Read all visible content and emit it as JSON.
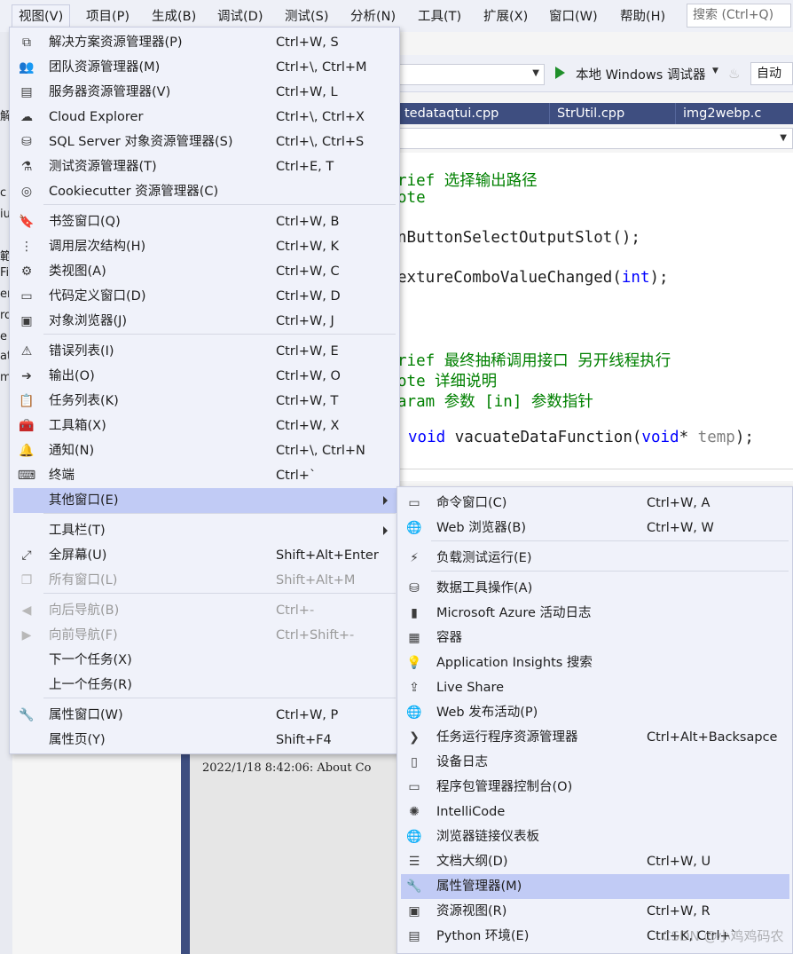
{
  "menubar": {
    "items": [
      "视图(V)",
      "项目(P)",
      "生成(B)",
      "调试(D)",
      "测试(S)",
      "分析(N)",
      "工具(T)",
      "扩展(X)",
      "窗口(W)",
      "帮助(H)"
    ],
    "search_placeholder": "搜索 (Ctrl+Q)"
  },
  "toolbar": {
    "run_label": "本地 Windows 调试器",
    "solution_config": "自动"
  },
  "tabs": [
    "tedataqtui.cpp",
    "StrUtil.cpp",
    "img2webp.c"
  ],
  "code": {
    "line1": {
      "a": "rief ",
      "b": "选择输出路径"
    },
    "line2": "ote",
    "line3": "nButtonSelectOutputSlot();",
    "line4": {
      "a": "extureComboValueChanged(",
      "b": "int",
      "c": ");"
    },
    "line5": {
      "a": "rief ",
      "b": "最终抽稀调用接口 另开线程执行"
    },
    "line6": {
      "a": "ote ",
      "b": "详细说明"
    },
    "line7": {
      "a": "aram ",
      "b": "参数 [in] 参数指针"
    },
    "line8": {
      "a": "void",
      "b": " vacuateDataFunction(",
      "c": "void",
      "d": "* ",
      "e": "temp",
      "f": ");"
    }
  },
  "left_strip": [
    "解",
    "c",
    "iu",
    "範",
    "Fi",
    "er",
    "ro",
    "e",
    "at",
    "mi"
  ],
  "output": {
    "line": "2022/1/18 8:42:06: About Co"
  },
  "view_menu": {
    "items": [
      {
        "icon": "solution-explorer-icon",
        "label": "解决方案资源管理器(P)",
        "shortcut": "Ctrl+W, S"
      },
      {
        "icon": "team-explorer-icon",
        "label": "团队资源管理器(M)",
        "shortcut": "Ctrl+\\, Ctrl+M"
      },
      {
        "icon": "server-explorer-icon",
        "label": "服务器资源管理器(V)",
        "shortcut": "Ctrl+W, L"
      },
      {
        "icon": "cloud-icon",
        "label": "Cloud Explorer",
        "shortcut": "Ctrl+\\, Ctrl+X"
      },
      {
        "icon": "sql-server-icon",
        "label": "SQL Server 对象资源管理器(S)",
        "shortcut": "Ctrl+\\, Ctrl+S"
      },
      {
        "icon": "test-explorer-icon",
        "label": "测试资源管理器(T)",
        "shortcut": "Ctrl+E, T"
      },
      {
        "icon": "cookiecutter-icon",
        "label": "Cookiecutter 资源管理器(C)",
        "shortcut": ""
      },
      {
        "icon": "bookmark-icon",
        "label": "书签窗口(Q)",
        "shortcut": "Ctrl+W, B"
      },
      {
        "icon": "call-hierarchy-icon",
        "label": "调用层次结构(H)",
        "shortcut": "Ctrl+W, K"
      },
      {
        "icon": "class-view-icon",
        "label": "类视图(A)",
        "shortcut": "Ctrl+W, C"
      },
      {
        "icon": "code-definition-icon",
        "label": "代码定义窗口(D)",
        "shortcut": "Ctrl+W, D"
      },
      {
        "icon": "object-browser-icon",
        "label": "对象浏览器(J)",
        "shortcut": "Ctrl+W, J"
      },
      {
        "icon": "error-list-icon",
        "label": "错误列表(I)",
        "shortcut": "Ctrl+W, E"
      },
      {
        "icon": "output-icon",
        "label": "输出(O)",
        "shortcut": "Ctrl+W, O"
      },
      {
        "icon": "task-list-icon",
        "label": "任务列表(K)",
        "shortcut": "Ctrl+W, T"
      },
      {
        "icon": "toolbox-icon",
        "label": "工具箱(X)",
        "shortcut": "Ctrl+W, X"
      },
      {
        "icon": "bell-icon",
        "label": "通知(N)",
        "shortcut": "Ctrl+\\, Ctrl+N"
      },
      {
        "icon": "terminal-icon",
        "label": "终端",
        "shortcut": "Ctrl+`"
      },
      {
        "icon": "",
        "label": "其他窗口(E)",
        "shortcut": ""
      },
      {
        "icon": "",
        "label": "工具栏(T)",
        "shortcut": ""
      },
      {
        "icon": "full-screen-icon",
        "label": "全屏幕(U)",
        "shortcut": "Shift+Alt+Enter"
      },
      {
        "icon": "all-windows-icon",
        "label": "所有窗口(L)",
        "shortcut": "Shift+Alt+M"
      },
      {
        "icon": "navigate-back-icon",
        "label": "向后导航(B)",
        "shortcut": "Ctrl+-"
      },
      {
        "icon": "navigate-forward-icon",
        "label": "向前导航(F)",
        "shortcut": "Ctrl+Shift+-"
      },
      {
        "icon": "",
        "label": "下一个任务(X)",
        "shortcut": ""
      },
      {
        "icon": "",
        "label": "上一个任务(R)",
        "shortcut": ""
      },
      {
        "icon": "wrench-icon",
        "label": "属性窗口(W)",
        "shortcut": "Ctrl+W, P"
      },
      {
        "icon": "",
        "label": "属性页(Y)",
        "shortcut": "Shift+F4"
      }
    ]
  },
  "other_windows_menu": {
    "items": [
      {
        "icon": "command-window-icon",
        "label": "命令窗口(C)",
        "shortcut": "Ctrl+W, A"
      },
      {
        "icon": "web-browser-icon",
        "label": "Web 浏览器(B)",
        "shortcut": "Ctrl+W, W"
      },
      {
        "icon": "load-test-icon",
        "label": "负载测试运行(E)",
        "shortcut": ""
      },
      {
        "icon": "data-tools-icon",
        "label": "数据工具操作(A)",
        "shortcut": ""
      },
      {
        "icon": "azure-log-icon",
        "label": "Microsoft Azure 活动日志",
        "shortcut": ""
      },
      {
        "icon": "container-icon",
        "label": "容器",
        "shortcut": ""
      },
      {
        "icon": "app-insights-icon",
        "label": "Application Insights 搜索",
        "shortcut": ""
      },
      {
        "icon": "live-share-icon",
        "label": "Live Share",
        "shortcut": ""
      },
      {
        "icon": "web-publish-icon",
        "label": "Web 发布活动(P)",
        "shortcut": ""
      },
      {
        "icon": "task-runner-icon",
        "label": "任务运行程序资源管理器",
        "shortcut": "Ctrl+Alt+Backsapce"
      },
      {
        "icon": "device-log-icon",
        "label": "设备日志",
        "shortcut": ""
      },
      {
        "icon": "package-console-icon",
        "label": "程序包管理器控制台(O)",
        "shortcut": ""
      },
      {
        "icon": "intellicode-icon",
        "label": "IntelliCode",
        "shortcut": ""
      },
      {
        "icon": "browser-link-icon",
        "label": "浏览器链接仪表板",
        "shortcut": ""
      },
      {
        "icon": "document-outline-icon",
        "label": "文档大纲(D)",
        "shortcut": "Ctrl+W, U"
      },
      {
        "icon": "property-manager-icon",
        "label": "属性管理器(M)",
        "shortcut": ""
      },
      {
        "icon": "resource-view-icon",
        "label": "资源视图(R)",
        "shortcut": "Ctrl+W, R"
      },
      {
        "icon": "python-env-icon",
        "label": "Python 环境(E)",
        "shortcut": "Ctrl+K, Ctrl+`"
      }
    ]
  },
  "watermark": "CSDN @小鸡鸡码农"
}
